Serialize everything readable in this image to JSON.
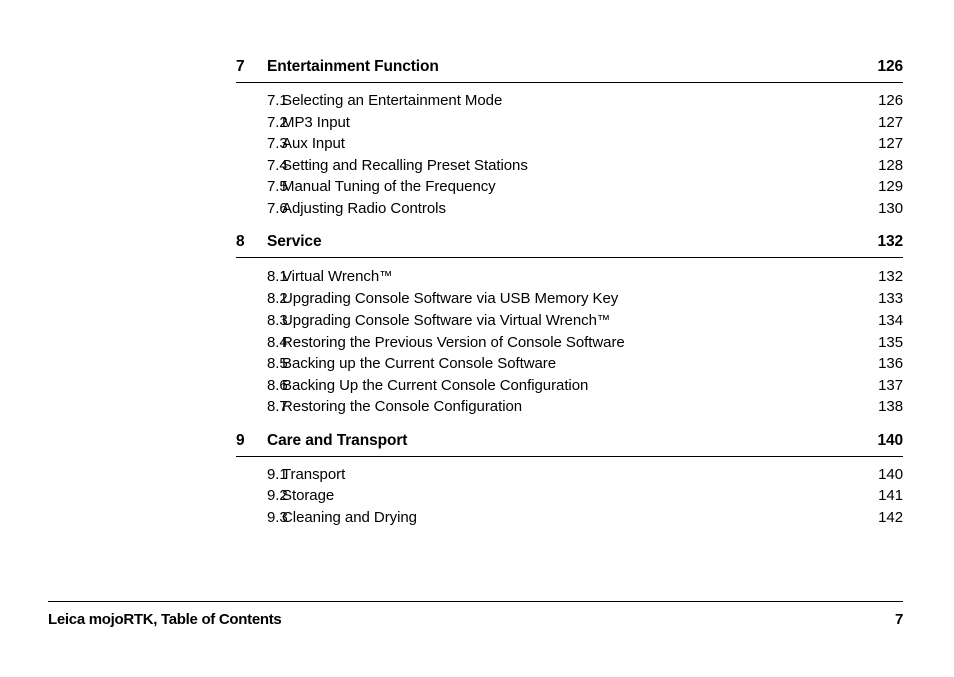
{
  "document": {
    "footer": {
      "title": "Leica mojoRTK, Table of Contents",
      "page_number": "7"
    },
    "chapters": [
      {
        "number": "7",
        "title": "Entertainment Function",
        "page": "126",
        "sections": [
          {
            "number": "7.1",
            "title": "Selecting an Entertainment Mode",
            "page": "126"
          },
          {
            "number": "7.2",
            "title": "MP3 Input",
            "page": "127"
          },
          {
            "number": "7.3",
            "title": "Aux Input",
            "page": "127"
          },
          {
            "number": "7.4",
            "title": "Setting and Recalling Preset Stations",
            "page": "128"
          },
          {
            "number": "7.5",
            "title": "Manual Tuning of the Frequency",
            "page": "129"
          },
          {
            "number": "7.6",
            "title": "Adjusting Radio Controls",
            "page": "130"
          }
        ]
      },
      {
        "number": "8",
        "title": "Service",
        "page": "132",
        "sections": [
          {
            "number": "8.1",
            "title": "Virtual Wrench™",
            "page": "132"
          },
          {
            "number": "8.2",
            "title": "Upgrading Console Software via USB Memory Key",
            "page": "133"
          },
          {
            "number": "8.3",
            "title": "Upgrading Console Software via Virtual Wrench™",
            "page": "134"
          },
          {
            "number": "8.4",
            "title": "Restoring the Previous Version of Console Software",
            "page": "135"
          },
          {
            "number": "8.5",
            "title": "Backing up the Current Console Software",
            "page": "136"
          },
          {
            "number": "8.6",
            "title": "Backing Up the Current Console Configuration",
            "page": "137"
          },
          {
            "number": "8.7",
            "title": "Restoring the Console Configuration",
            "page": "138"
          }
        ]
      },
      {
        "number": "9",
        "title": "Care and Transport",
        "page": "140",
        "sections": [
          {
            "number": "9.1",
            "title": "Transport",
            "page": "140"
          },
          {
            "number": "9.2",
            "title": "Storage",
            "page": "141"
          },
          {
            "number": "9.3",
            "title": "Cleaning and Drying",
            "page": "142"
          }
        ]
      }
    ]
  }
}
